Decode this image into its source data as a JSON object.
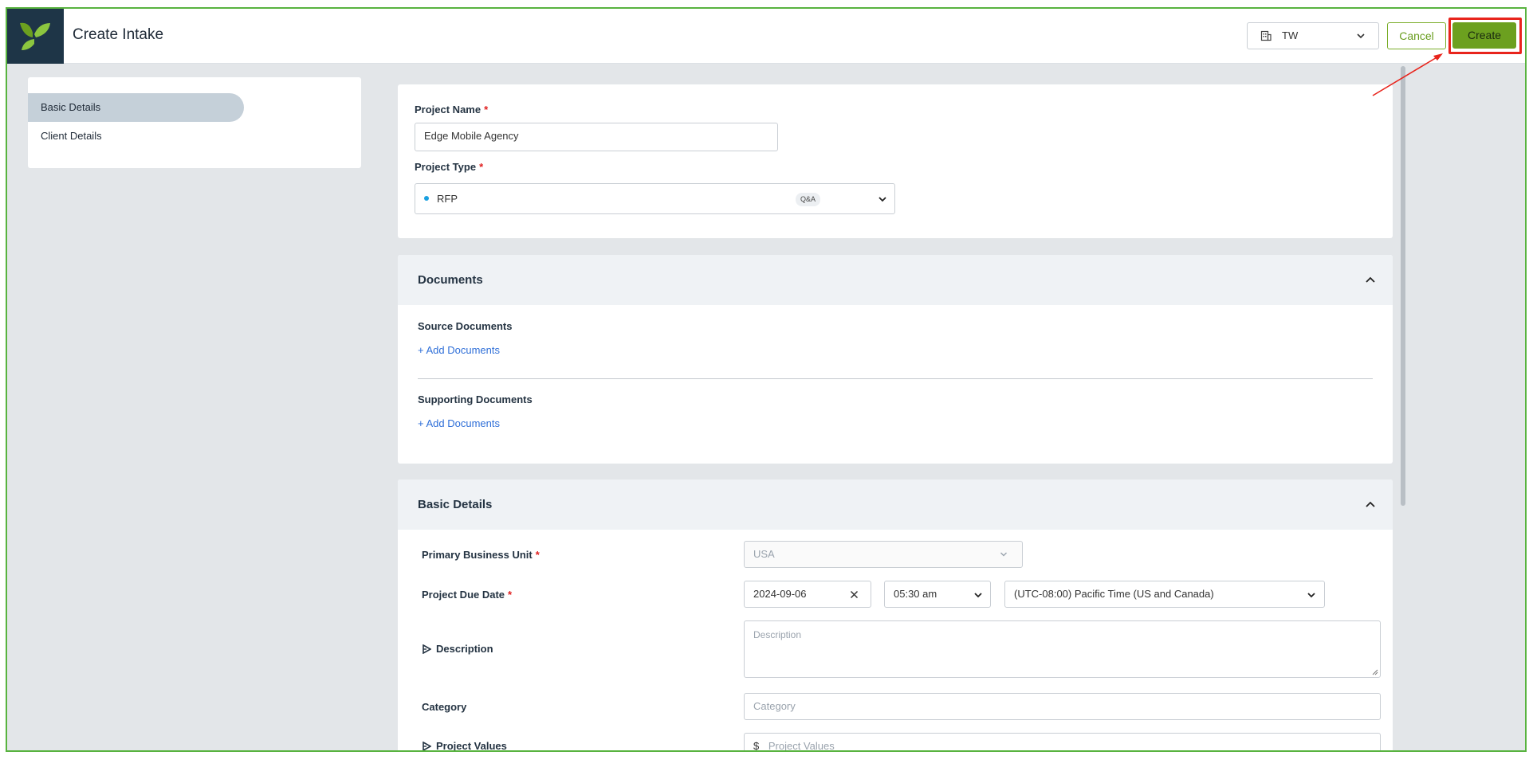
{
  "header": {
    "title": "Create Intake",
    "workspace_value": "TW",
    "cancel_label": "Cancel",
    "create_label": "Create"
  },
  "sidebar": {
    "items": [
      {
        "label": "Basic Details",
        "active": true
      },
      {
        "label": "Client Details",
        "active": false
      }
    ]
  },
  "project": {
    "name_label": "Project Name",
    "name_value": "Edge Mobile Agency",
    "type_label": "Project Type",
    "type_value": "RFP",
    "type_tag": "Q&A",
    "required_mark": "*"
  },
  "documents": {
    "title": "Documents",
    "source_label": "Source Documents",
    "source_add": "+ Add Documents",
    "supporting_label": "Supporting Documents",
    "supporting_add": "+ Add Documents"
  },
  "basic_details": {
    "title": "Basic Details",
    "business_unit_label": "Primary Business Unit",
    "business_unit_placeholder": "USA",
    "due_date_label": "Project Due Date",
    "due_date_value": "2024-09-06",
    "due_time_value": "05:30 am",
    "timezone_value": "(UTC-08:00) Pacific Time (US and Canada)",
    "description_label": "Description",
    "description_placeholder": "Description",
    "category_label": "Category",
    "category_placeholder": "Category",
    "project_values_label": "Project Values",
    "currency_symbol": "$",
    "project_values_placeholder": "Project Values"
  },
  "colors": {
    "brand_green": "#6ca01f",
    "highlight_red": "#e8241c",
    "link_blue": "#2f6fd8",
    "dot_blue": "#1aa0e0"
  }
}
